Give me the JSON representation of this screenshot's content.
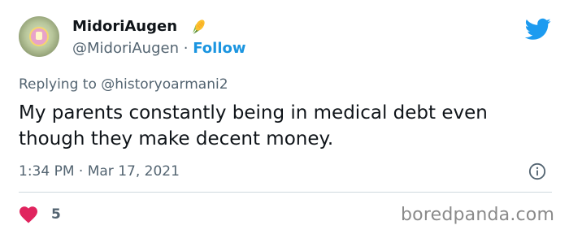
{
  "author": {
    "display_name": "MidoriAugen",
    "name_emoji": "corn-icon",
    "handle": "@MidoriAugen",
    "separator": "·",
    "follow_label": "Follow"
  },
  "header": {
    "brand_icon": "twitter-bird-icon",
    "brand_color": "#1d9bf0"
  },
  "tweet": {
    "replying_to": "Replying to @historyoarmani2",
    "text": "My parents constantly being in medical debt even though they make decent money.",
    "timestamp": "1:34 PM · Mar 17, 2021",
    "info_icon": "info-icon"
  },
  "engagement": {
    "like_icon": "heart-icon",
    "like_color": "#e0245e",
    "like_count": "5"
  },
  "watermark": "boredpanda.com",
  "colors": {
    "text_primary": "#0f1419",
    "text_secondary": "#536471",
    "link": "#1b95e0",
    "divider": "#cfd9de"
  }
}
